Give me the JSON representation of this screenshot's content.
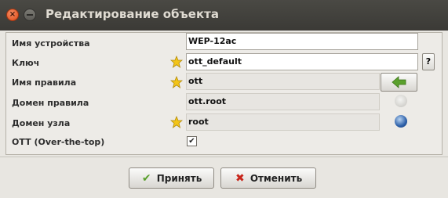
{
  "window": {
    "title": "Редактирование объекта"
  },
  "form": {
    "device_name": {
      "label": "Имя устройства",
      "value": "WEP-12ac"
    },
    "key": {
      "label": "Ключ",
      "value": "ott_default",
      "help_label": "?"
    },
    "rule_name": {
      "label": "Имя правила",
      "value": "ott"
    },
    "rule_domain": {
      "label": "Домен правила",
      "value": "ott.root"
    },
    "node_domain": {
      "label": "Домен узла",
      "value": "root"
    },
    "ott": {
      "label": "OTT (Over-the-top)",
      "checked_glyph": "✔"
    }
  },
  "buttons": {
    "accept": {
      "label": "Принять",
      "icon": "check-icon"
    },
    "cancel": {
      "label": "Отменить",
      "icon": "x-icon"
    }
  },
  "colors": {
    "titlebar": "#3b3a36",
    "accent_green": "#5aa02c",
    "accent_red": "#c8261b",
    "star": "#f2c418"
  }
}
